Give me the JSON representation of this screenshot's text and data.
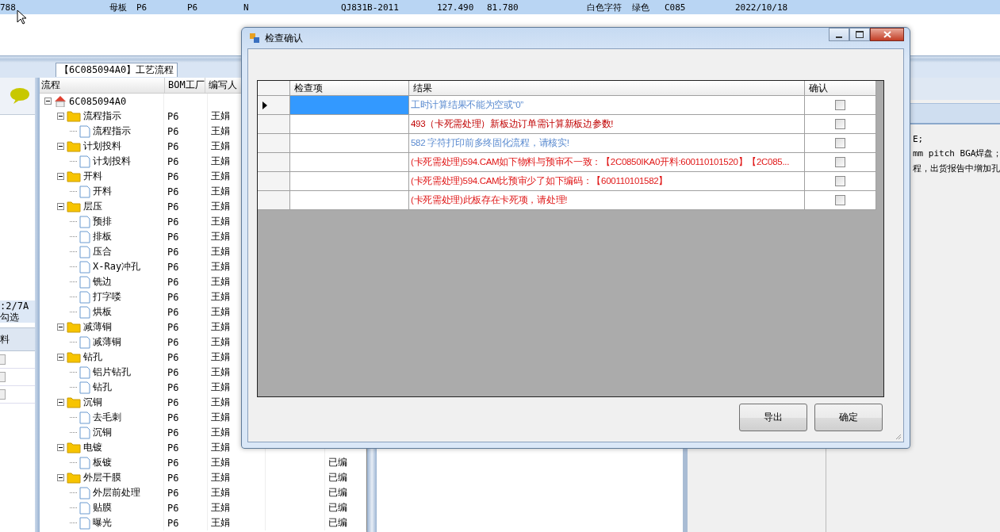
{
  "top_row": [
    "788",
    "母板",
    "P6",
    "P6",
    "N",
    "QJ831B-2011",
    "127.490",
    "81.780",
    "白色字符",
    "绿色",
    "C085",
    "2022/10/18"
  ],
  "tab": {
    "label": "【6C085094A0】工艺流程",
    "selected": true
  },
  "left_panel": {
    "lines": [
      ":2/7A",
      "勾选"
    ],
    "column": "料"
  },
  "tree": {
    "columns": [
      "流程",
      "BOM工厂",
      "编写人"
    ],
    "root": {
      "label": "6C085094A0",
      "expanded": true,
      "children": [
        {
          "label": "流程指示",
          "bom": "P6",
          "writer": "王娟",
          "expanded": true,
          "children": [
            {
              "label": "流程指示",
              "bom": "P6",
              "writer": "王娟"
            }
          ]
        },
        {
          "label": "计划投料",
          "bom": "P6",
          "writer": "王娟",
          "expanded": true,
          "children": [
            {
              "label": "计划投料",
              "bom": "P6",
              "writer": "王娟"
            }
          ]
        },
        {
          "label": "开料",
          "bom": "P6",
          "writer": "王娟",
          "expanded": true,
          "children": [
            {
              "label": "开料",
              "bom": "P6",
              "writer": "王娟"
            }
          ]
        },
        {
          "label": "层压",
          "bom": "P6",
          "writer": "王娟",
          "expanded": true,
          "children": [
            {
              "label": "预排",
              "bom": "P6",
              "writer": "王娟"
            },
            {
              "label": "排板",
              "bom": "P6",
              "writer": "王娟"
            },
            {
              "label": "压合",
              "bom": "P6",
              "writer": "王娟"
            },
            {
              "label": "X-Ray冲孔",
              "bom": "P6",
              "writer": "王娟"
            },
            {
              "label": "铣边",
              "bom": "P6",
              "writer": "王娟"
            },
            {
              "label": "打字喽",
              "bom": "P6",
              "writer": "王娟"
            },
            {
              "label": "烘板",
              "bom": "P6",
              "writer": "王娟"
            }
          ]
        },
        {
          "label": "减薄铜",
          "bom": "P6",
          "writer": "王娟",
          "expanded": true,
          "children": [
            {
              "label": "减薄铜",
              "bom": "P6",
              "writer": "王娟"
            }
          ]
        },
        {
          "label": "钻孔",
          "bom": "P6",
          "writer": "王娟",
          "expanded": true,
          "children": [
            {
              "label": "铝片钻孔",
              "bom": "P6",
              "writer": "王娟"
            },
            {
              "label": "钻孔",
              "bom": "P6",
              "writer": "王娟"
            }
          ]
        },
        {
          "label": "沉铜",
          "bom": "P6",
          "writer": "王娟",
          "expanded": true,
          "children": [
            {
              "label": "去毛刺",
              "bom": "P6",
              "writer": "王娟"
            },
            {
              "label": "沉铜",
              "bom": "P6",
              "writer": "王娟"
            }
          ]
        },
        {
          "label": "电镀",
          "bom": "P6",
          "writer": "王娟",
          "expanded": true,
          "children": [
            {
              "label": "板镀",
              "bom": "P6",
              "writer": "王娟",
              "status": "已编"
            }
          ]
        },
        {
          "label": "外层干膜",
          "bom": "P6",
          "writer": "王娟",
          "status": "已编",
          "expanded": true,
          "children": [
            {
              "label": "外层前处理",
              "bom": "P6",
              "writer": "王娟",
              "status": "已编"
            },
            {
              "label": "贴膜",
              "bom": "P6",
              "writer": "王娟",
              "status": "已编"
            },
            {
              "label": "曝光",
              "bom": "P6",
              "writer": "王娟",
              "status": "已编"
            }
          ]
        }
      ]
    }
  },
  "right_panel": {
    "lines": [
      "E;",
      "mm pitch BGA焊盘；",
      "程，出货报告中增加孔"
    ]
  },
  "dialog": {
    "title": "检查确认",
    "columns": [
      "检查项",
      "结果",
      "确认"
    ],
    "rows": [
      {
        "item": "",
        "result": "工时计算结果不能为空或“0”",
        "color": "#5b8bd0",
        "checked": false,
        "selected": true
      },
      {
        "item": "",
        "result": "493（卡死需处理）新板边订单需计算新板边参数!",
        "color": "#c00000",
        "checked": false,
        "selected": false
      },
      {
        "item": "",
        "result": "582 字符打印前多终固化流程，请核实!",
        "color": "#5b8bd0",
        "checked": false,
        "selected": false
      },
      {
        "item": "",
        "result": "(卡死需处理)594.CAM如下物料与预审不一致：【2C0850IKA0开料:600110101520】【2C085...",
        "color": "#e01818",
        "checked": false,
        "selected": false
      },
      {
        "item": "",
        "result": "(卡死需处理)594.CAM比预审少了如下编码：【600110101582】",
        "color": "#e01818",
        "checked": false,
        "selected": false
      },
      {
        "item": "",
        "result": "(卡死需处理)此板存在卡死项，请处理!",
        "color": "#e01818",
        "checked": false,
        "selected": false
      }
    ],
    "buttons": [
      "导出",
      "确定"
    ]
  }
}
